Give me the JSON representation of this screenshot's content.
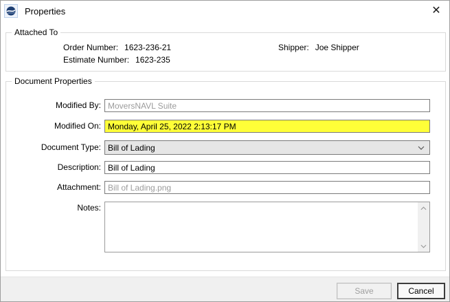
{
  "window": {
    "title": "Properties",
    "close_glyph": "✕"
  },
  "attached_to": {
    "legend": "Attached To",
    "order_number_label": "Order Number:",
    "order_number_value": "1623-236-21",
    "estimate_number_label": "Estimate Number:",
    "estimate_number_value": "1623-235",
    "shipper_label": "Shipper:",
    "shipper_value": "Joe Shipper"
  },
  "doc": {
    "legend": "Document Properties",
    "modified_by_label": "Modified By:",
    "modified_by_value": "MoversNAVL Suite",
    "modified_on_label": "Modified On:",
    "modified_on_value": "Monday, April 25, 2022 2:13:17 PM",
    "document_type_label": "Document Type:",
    "document_type_value": "Bill of Lading",
    "description_label": "Description:",
    "description_value": "Bill of Lading",
    "attachment_label": "Attachment:",
    "attachment_value": "Bill of Lading.png",
    "notes_label": "Notes:",
    "notes_value": ""
  },
  "footer": {
    "save_label": "Save",
    "save_disabled": true,
    "cancel_label": "Cancel"
  },
  "colors": {
    "modified_on_highlight": "#ffff38",
    "combobox_bg": "#e6e6e6",
    "footer_bg": "#f0f0f0",
    "logo_navy": "#1e3f73",
    "readonly_text": "#9b9b9b"
  }
}
